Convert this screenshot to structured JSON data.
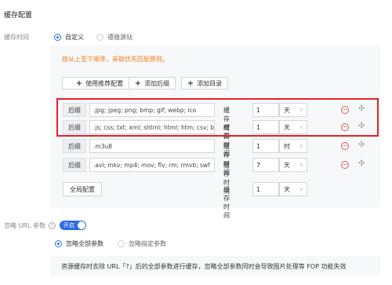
{
  "section_title": "缓存配置",
  "cache_time": {
    "label": "缓存时间",
    "options": [
      {
        "label": "自定义",
        "selected": true
      },
      {
        "label": "遵循源站",
        "selected": false
      }
    ]
  },
  "hint": "按从上至下顺序，采取优先匹配原则。",
  "buttons": {
    "use_recommended": "使用推荐配置",
    "add_suffix": "添加后缀",
    "add_directory": "添加目录"
  },
  "rules": [
    {
      "type": "后缀",
      "value": ".jpg; jpeg; png; bmp; gif; webp; ico",
      "time_label": "缓存时间",
      "time": "1",
      "unit": "天",
      "deletable": true
    },
    {
      "type": "后缀",
      "value": ".js; css; txt; xml; shtml; html; htm; csv; ba",
      "time_label": "缓存时间",
      "time": "1",
      "unit": "天",
      "deletable": true
    },
    {
      "type": "后缀",
      "value": ".m3u8",
      "time_label": "缓存时间",
      "time": "1",
      "unit": "时",
      "deletable": true
    },
    {
      "type": "后缀",
      "value": ".avi; mkv; mp4; mov; flv; rm; rmvb; swf",
      "time_label": "缓存时间",
      "time": "7",
      "unit": "天",
      "deletable": true
    }
  ],
  "global_rule": {
    "type": "全局配置",
    "time_label": "缓存时间",
    "time": "1",
    "unit": "天"
  },
  "ignore_url_params": {
    "label": "忽略 URL 参数",
    "toggle_label": "开启",
    "enabled": true,
    "options": [
      {
        "label": "忽略全部参数",
        "selected": true
      },
      {
        "label": "忽略指定参数",
        "selected": false
      }
    ],
    "notice": "资源缓存时去除 URL「?」后的全部参数进行缓存，忽略全部参数同时会导致图片处理等 FOP 功能失效"
  },
  "colors": {
    "accent": "#2e6be6",
    "warning": "#f07d1a",
    "highlight": "#e5202a",
    "danger": "#e25959"
  }
}
